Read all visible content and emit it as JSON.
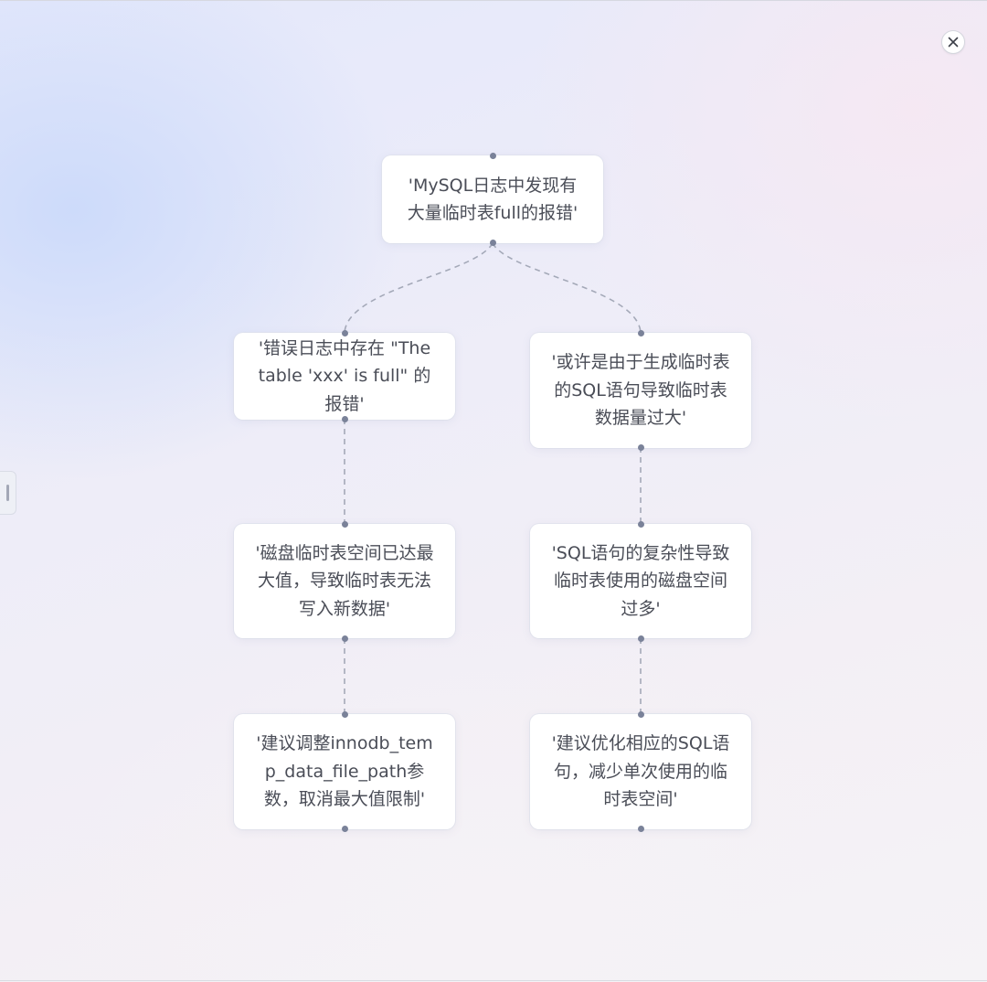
{
  "nodes": [
    {
      "id": "root",
      "text": "'MySQL日志中发现有大量临时表full的报错'"
    },
    {
      "id": "left1",
      "text": "'错误日志中存在 \"The table 'xxx' is full\" 的报错'"
    },
    {
      "id": "right1",
      "text": "'或许是由于生成临时表的SQL语句导致临时表数据量过大'"
    },
    {
      "id": "left2",
      "text": "'磁盘临时表空间已达最大值，导致临时表无法写入新数据'"
    },
    {
      "id": "right2",
      "text": "'SQL语句的复杂性导致临时表使用的磁盘空间过多'"
    },
    {
      "id": "left3",
      "text": "'建议调整innodb_temp_data_file_path参数，取消最大值限制'"
    },
    {
      "id": "right3",
      "text": "'建议优化相应的SQL语句，减少单次使用的临时表空间'"
    }
  ],
  "edges": [
    {
      "from": "root",
      "to": "left1"
    },
    {
      "from": "root",
      "to": "right1"
    },
    {
      "from": "left1",
      "to": "left2"
    },
    {
      "from": "left2",
      "to": "left3"
    },
    {
      "from": "right1",
      "to": "right2"
    },
    {
      "from": "right2",
      "to": "right3"
    }
  ],
  "icons": {
    "close": "close-icon",
    "handle": "drag-handle-icon"
  },
  "colors": {
    "edge": "#a4a9b8",
    "dot": "#7a8299",
    "node_bg": "#ffffff",
    "text": "#4a4d57"
  }
}
